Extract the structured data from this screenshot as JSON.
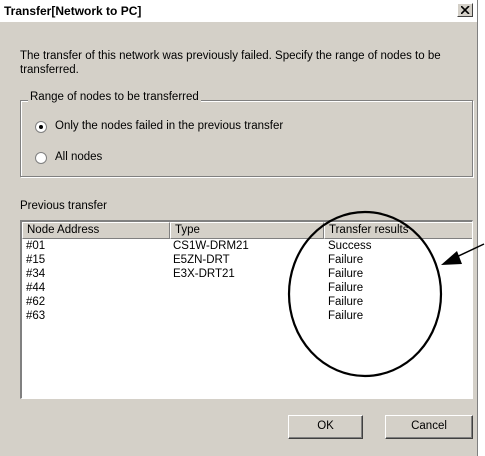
{
  "window": {
    "title": "Transfer[Network to PC]"
  },
  "description": "The transfer of this network was previously failed. Specify the range of nodes to be transferred.",
  "range_group": {
    "legend": "Range of nodes to be transferred",
    "options": [
      {
        "label": "Only the nodes failed in the previous transfer",
        "selected": true
      },
      {
        "label": "All nodes",
        "selected": false
      }
    ]
  },
  "previous_transfer": {
    "label": "Previous transfer",
    "columns": [
      "Node Address",
      "Type",
      "Transfer results"
    ],
    "rows": [
      [
        "#01",
        "CS1W-DRM21",
        "Success"
      ],
      [
        "#15",
        "E5ZN-DRT",
        "Failure"
      ],
      [
        "#34",
        "E3X-DRT21",
        "Failure"
      ],
      [
        "#44",
        "",
        "Failure"
      ],
      [
        "#62",
        "",
        "Failure"
      ],
      [
        "#63",
        "",
        "Failure"
      ]
    ]
  },
  "buttons": {
    "ok": "OK",
    "cancel": "Cancel"
  },
  "icons": {
    "close": "close-icon",
    "callout": "callout-ellipse-arrow"
  }
}
